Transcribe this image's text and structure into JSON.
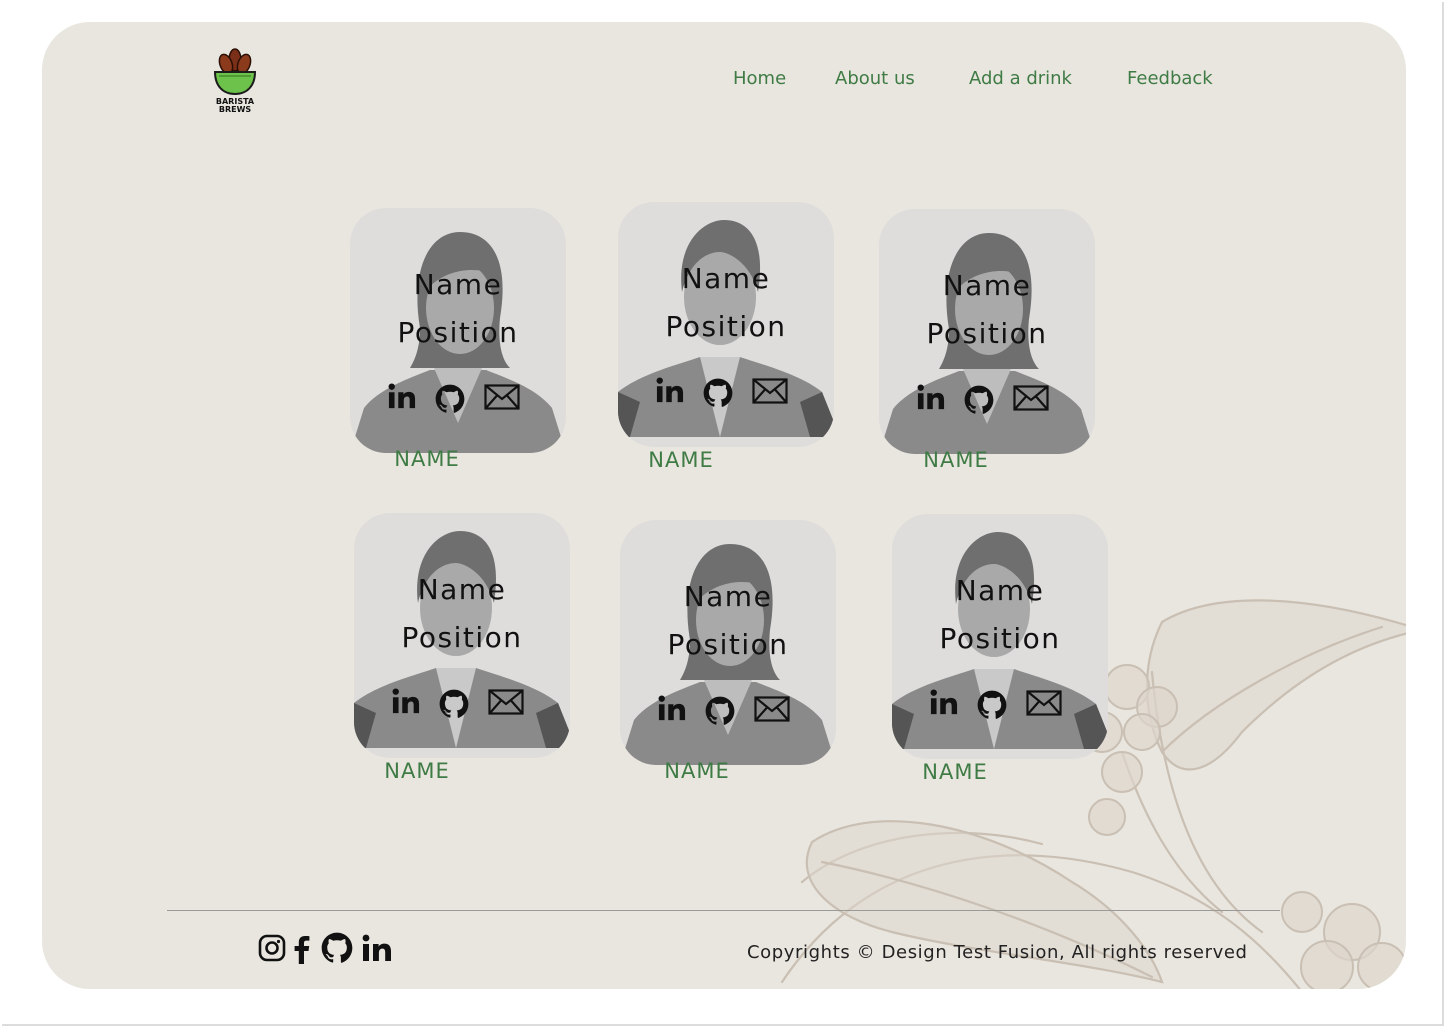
{
  "brand": {
    "logo_text_line1": "BARISTA",
    "logo_text_line2": "BREWS"
  },
  "nav": {
    "items": [
      {
        "label": "Home"
      },
      {
        "label": "About us"
      },
      {
        "label": "Add a drink"
      },
      {
        "label": "Feedback"
      }
    ]
  },
  "team": {
    "cards": [
      {
        "name": "Name",
        "position": "Position",
        "label": "NAME",
        "avatar": "female-avatar"
      },
      {
        "name": "Name",
        "position": "Position",
        "label": "NAME",
        "avatar": "male-avatar"
      },
      {
        "name": "Name",
        "position": "Position",
        "label": "NAME",
        "avatar": "female-avatar"
      },
      {
        "name": "Name",
        "position": "Position",
        "label": "NAME",
        "avatar": "male-avatar"
      },
      {
        "name": "Name",
        "position": "Position",
        "label": "NAME",
        "avatar": "female-avatar"
      },
      {
        "name": "Name",
        "position": "Position",
        "label": "NAME",
        "avatar": "male-avatar"
      }
    ],
    "card_icons": [
      "linkedin-icon",
      "github-icon",
      "mail-icon"
    ]
  },
  "footer": {
    "social_icons": [
      "instagram-icon",
      "facebook-icon",
      "github-icon",
      "linkedin-icon"
    ],
    "copyright": "Copyrights © Design Test Fusion, All rights reserved"
  },
  "colors": {
    "panel_background": "#e9e6df",
    "accent_green": "#3f7b45",
    "text_dark": "#111111"
  }
}
